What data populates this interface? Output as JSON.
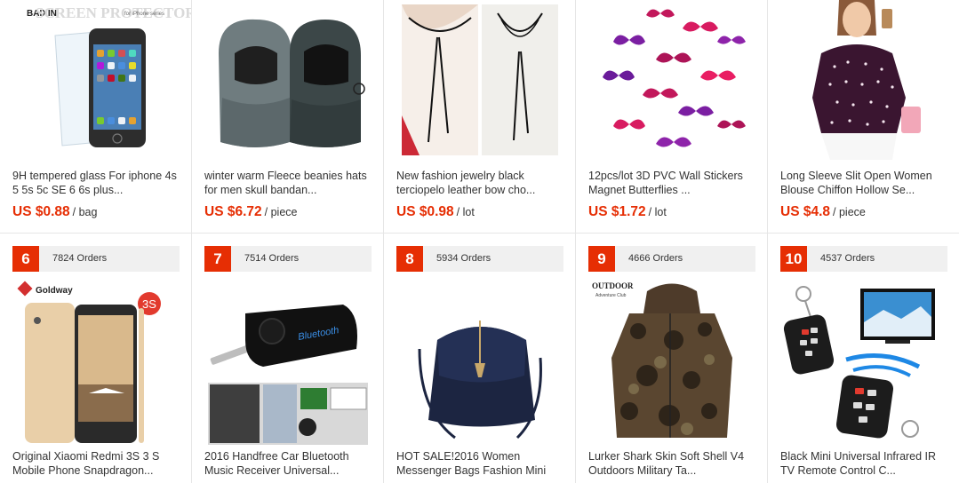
{
  "top_row": [
    {
      "brand": "BAIXIN",
      "banner": "SCREEN PROTECTOR",
      "banner_sub": "for iPhone series",
      "title": "9H tempered glass For iphone 4s 5 5s 5c SE 6 6s plus...",
      "price": "US $0.88",
      "unit": "/ bag"
    },
    {
      "title": "winter warm Fleece beanies hats for men skull bandan...",
      "price": "US $6.72",
      "unit": "/ piece"
    },
    {
      "title": "New fashion jewelry black terciopelo leather bow cho...",
      "price": "US $0.98",
      "unit": "/ lot"
    },
    {
      "title": "12pcs/lot 3D PVC Wall Stickers Magnet Butterflies ...",
      "price": "US $1.72",
      "unit": "/ lot"
    },
    {
      "title": "Long Sleeve Slit Open Women Blouse Chiffon Hollow Se...",
      "price": "US $4.8",
      "unit": "/ piece"
    }
  ],
  "bottom_row": [
    {
      "rank": "6",
      "orders": "7824 Orders",
      "brand": "Goldway",
      "badge": "3S",
      "title": "Original Xiaomi Redmi 3S 3 S Mobile Phone Snapdragon..."
    },
    {
      "rank": "7",
      "orders": "7514 Orders",
      "device_label": "Bluetooth",
      "title": "2016 Handfree Car Bluetooth Music Receiver Universal..."
    },
    {
      "rank": "8",
      "orders": "5934 Orders",
      "title": "HOT SALE!2016 Women Messenger Bags Fashion Mini"
    },
    {
      "rank": "9",
      "orders": "4666 Orders",
      "brand": "OUTDOOR",
      "brand_sub": "Adventure Club",
      "title": "Lurker Shark Skin Soft Shell V4 Outdoors Military Ta..."
    },
    {
      "rank": "10",
      "orders": "4537 Orders",
      "title": "Black Mini Universal Infrared IR TV Remote Control C..."
    }
  ],
  "colors": {
    "price": "#e62e04",
    "rank_bg": "#e62e04",
    "orders_bg": "#f0f0f0",
    "divider": "#e6e6e6"
  }
}
